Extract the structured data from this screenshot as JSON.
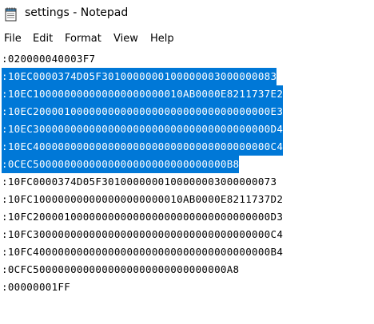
{
  "window": {
    "title": "settings - Notepad",
    "icon": "notepad-icon"
  },
  "menu": [
    "File",
    "Edit",
    "Format",
    "View",
    "Help"
  ],
  "editor": {
    "selection_color": "#0078d7",
    "lines": [
      {
        "text": ":020000040003F7",
        "selected": false
      },
      {
        "text": ":10EC0000374D05F3010000000100000003000000083",
        "selected": true
      },
      {
        "text": ":10EC100000000000000000000010AB0000E8211737E2",
        "selected": true
      },
      {
        "text": ":10EC20000100000000000000000000000000000000E3",
        "selected": true
      },
      {
        "text": ":10EC30000000000000000000000000000000000000D4",
        "selected": true
      },
      {
        "text": ":10EC40000000000000000000000000000000000000C4",
        "selected": true
      },
      {
        "text": ":0CEC5000000000000000000000000000000B8",
        "selected": true
      },
      {
        "text": ":10FC0000374D05F3010000000100000003000000073",
        "selected": false
      },
      {
        "text": ":10FC100000000000000000000010AB0000E8211737D2",
        "selected": false
      },
      {
        "text": ":10FC20000100000000000000000000000000000000D3",
        "selected": false
      },
      {
        "text": ":10FC30000000000000000000000000000000000000C4",
        "selected": false
      },
      {
        "text": ":10FC40000000000000000000000000000000000000B4",
        "selected": false
      },
      {
        "text": ":0CFC5000000000000000000000000000000A8",
        "selected": false
      },
      {
        "text": ":00000001FF",
        "selected": false
      }
    ]
  }
}
